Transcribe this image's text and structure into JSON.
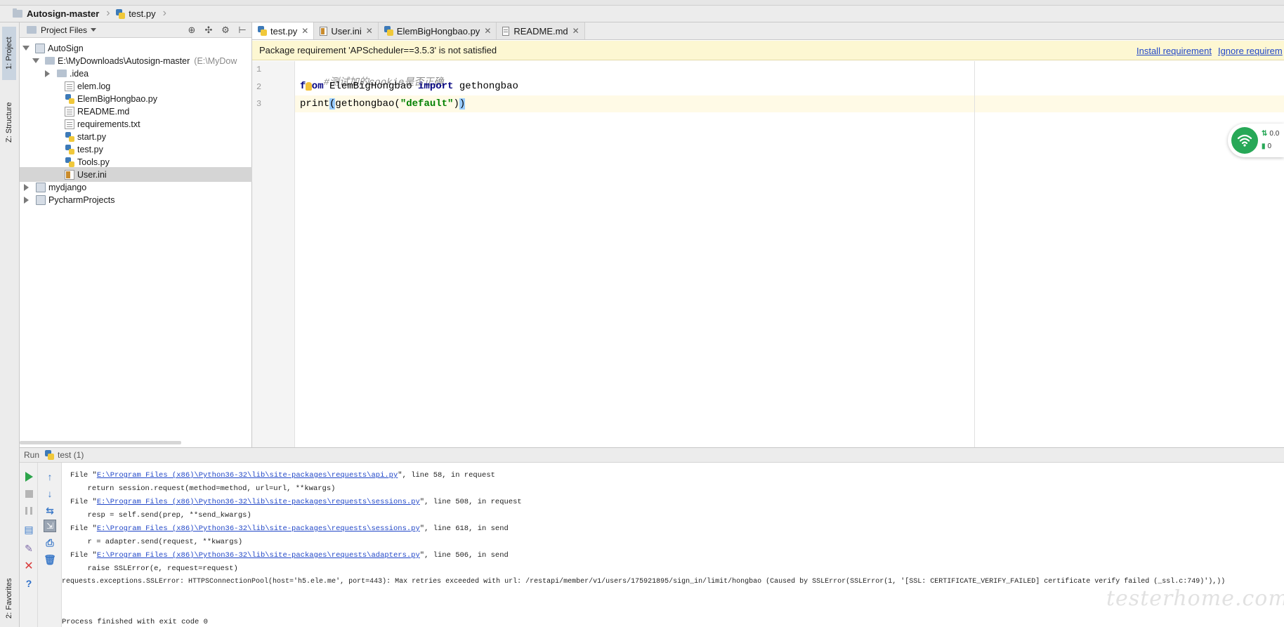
{
  "breadcrumb": {
    "project": "Autosign-master",
    "file": "test.py"
  },
  "tool_windows": {
    "project": "1: Project",
    "structure": "Z: Structure",
    "favorites": "2: Favorites"
  },
  "project_panel": {
    "title": "Project Files",
    "tree": [
      {
        "label": "AutoSign",
        "icon": "project-icon",
        "depth": 0,
        "expanded": true
      },
      {
        "label": "E:\\MyDownloads\\Autosign-master",
        "extra": "(E:\\MyDow",
        "icon": "folder-icon",
        "depth": 1,
        "expanded": true
      },
      {
        "label": ".idea",
        "icon": "folder-icon",
        "depth": 2,
        "expanded": false
      },
      {
        "label": "elem.log",
        "icon": "text-file-icon",
        "depth": 2
      },
      {
        "label": "ElemBigHongbao.py",
        "icon": "python-file-icon",
        "depth": 2
      },
      {
        "label": "README.md",
        "icon": "text-file-icon",
        "depth": 2
      },
      {
        "label": "requirements.txt",
        "icon": "text-file-icon",
        "depth": 2
      },
      {
        "label": "start.py",
        "icon": "python-file-icon",
        "depth": 2
      },
      {
        "label": "test.py",
        "icon": "python-file-icon",
        "depth": 2
      },
      {
        "label": "Tools.py",
        "icon": "python-file-icon",
        "depth": 2
      },
      {
        "label": "User.ini",
        "icon": "ini-file-icon",
        "depth": 2,
        "selected": true
      },
      {
        "label": "mydjango",
        "icon": "project-icon",
        "depth": 0,
        "expanded": false
      },
      {
        "label": "PycharmProjects",
        "icon": "project-icon",
        "depth": 0,
        "expanded": false
      }
    ]
  },
  "editor_tabs": [
    {
      "label": "test.py",
      "icon": "python-file-icon",
      "active": true
    },
    {
      "label": "User.ini",
      "icon": "ini-file-icon",
      "active": false
    },
    {
      "label": "ElemBigHongbao.py",
      "icon": "python-file-icon",
      "active": false
    },
    {
      "label": "README.md",
      "icon": "markdown-file-icon",
      "active": false
    }
  ],
  "banner": {
    "message": "Package requirement 'APScheduler==3.5.3' is not satisfied",
    "install_link": "Install requirement",
    "ignore_link": "Ignore requirem"
  },
  "editor": {
    "line_numbers": [
      "1",
      "2",
      "3"
    ],
    "line1_comment": "#测试加的cookie是否正确",
    "line2": {
      "kw_from": "from",
      "module": " ElemBigHongbao ",
      "kw_import": "import",
      "name": " gethongbao"
    },
    "line3": {
      "fn": "print",
      "open": "(",
      "call": "gethongbao(",
      "arg": "\"default\"",
      "close_inner": ")",
      "close": ")"
    }
  },
  "network_widget": {
    "speed": "0.0",
    "count": "0",
    "colors": {
      "accent": "#27a857"
    }
  },
  "run_panel": {
    "label": "Run",
    "config": "test (1)",
    "console": [
      {
        "prefix": "File \"",
        "link": "E:\\Program Files (x86)\\Python36-32\\lib\\site-packages\\requests\\api.py",
        "suffix": "\", line 58, in request",
        "indent": true
      },
      {
        "text": "  return session.request(method=method, url=url, **kwargs)",
        "indent": true
      },
      {
        "prefix": "File \"",
        "link": "E:\\Program Files (x86)\\Python36-32\\lib\\site-packages\\requests\\sessions.py",
        "suffix": "\", line 508, in request",
        "indent": true
      },
      {
        "text": "  resp = self.send(prep, **send_kwargs)",
        "indent": true
      },
      {
        "prefix": "File \"",
        "link": "E:\\Program Files (x86)\\Python36-32\\lib\\site-packages\\requests\\sessions.py",
        "suffix": "\", line 618, in send",
        "indent": true
      },
      {
        "text": "  r = adapter.send(request, **kwargs)",
        "indent": true
      },
      {
        "prefix": "File \"",
        "link": "E:\\Program Files (x86)\\Python36-32\\lib\\site-packages\\requests\\adapters.py",
        "suffix": "\", line 506, in send",
        "indent": true
      },
      {
        "text": "  raise SSLError(e, request=request)",
        "indent": true
      },
      {
        "text": "requests.exceptions.SSLError: HTTPSConnectionPool(host='h5.ele.me', port=443): Max retries exceeded with url: /restapi/member/v1/users/175921895/sign_in/limit/hongbao (Caused by SSLError(SSLError(1, '[SSL: CERTIFICATE_VERIFY_FAILED] certificate verify failed (_ssl.c:749)'),))",
        "indent": false
      },
      {
        "text": "",
        "indent": false
      },
      {
        "text": "Process finished with exit code 0",
        "indent": false
      }
    ]
  },
  "watermark": "testerhome.com"
}
